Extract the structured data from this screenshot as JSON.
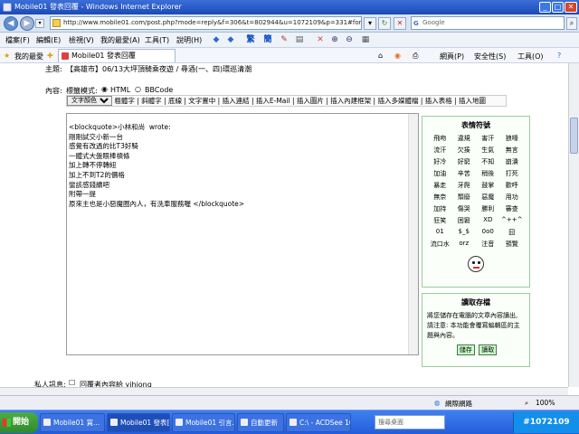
{
  "window": {
    "title": "Mobile01 發表回覆 - Windows Internet Explorer",
    "url": "http://www.mobile01.com/post.php?mode=reply&f=306&t=802944&u=1072109&p=331#form",
    "search_placeholder": "Google"
  },
  "menu": {
    "items": [
      "檔案(F)",
      "編輯(E)",
      "檢視(V)",
      "我的最愛(A)",
      "工具(T)",
      "說明(H)"
    ],
    "toolbar_text": [
      "繁",
      "簡"
    ]
  },
  "favbar": {
    "favorites_label": "我的最愛",
    "tab_label": "Mobile01 發表回覆",
    "page_label": "網頁(P)",
    "safety_label": "安全性(S)",
    "tools_label": "工具(O)"
  },
  "form": {
    "subject_label": "主題:",
    "subject_text": "【高雄市】06/13大坪頂騎乘夜遊 / 尋酒(一、四)環巡清潮",
    "content_label": "內容:",
    "mode_label": "標籤模式:",
    "mode_html": "HTML",
    "mode_bbcode": "BBCode",
    "color_select": "文字顏色",
    "format_links": [
      "粗體字",
      "斜體字",
      "底線",
      "文字置中",
      "插入連結",
      "插入E-Mail",
      "插入圖片",
      "插入內建框架",
      "插入多媒體檔",
      "插入表格",
      "插入地圖"
    ],
    "body_lines": [
      "<blockquote>小林和尚  wrote:",
      "剛剛試交小新一台",
      "感覺有改過的比T3好騎",
      "一體式大盤眼棒槓條",
      "加上轉不停轉紐",
      "加上不到T2的價格",
      "蠻該感錢續吧",
      "附帶一提",
      "原來主也是小惡魔圈內人，有洗車服務喔 </blockquote>"
    ],
    "private_label": "私人訊息:",
    "private_text": "回覆者內容給 yihjong"
  },
  "emoticons": {
    "title": "表情符號",
    "items": [
      "飛吻",
      "違規",
      "害汗",
      "狼嚎",
      "流汗",
      "欠揍",
      "生氣",
      "無言",
      "好冷",
      "好窮",
      "不知",
      "崩潰",
      "加油",
      "辛苦",
      "稍後",
      "打死",
      "暴走",
      "牙爬",
      "鼓掌",
      "歡呼",
      "無奈",
      "頹廢",
      "惡魔",
      "用功",
      "加持",
      "傷哭",
      "勝利",
      "審查",
      "狂笑",
      "困窘",
      "XD",
      "^++^",
      "01",
      "$_$",
      "0o0",
      "囧",
      "流口水",
      "orz",
      "注音",
      "預覽"
    ]
  },
  "autosave": {
    "title": "讀取存檔",
    "description": "將您儲存在電腦的文章內容讀出, 請注意: 本功能會覆寫編輯區的主題與內容。",
    "save_button": "儲存",
    "load_button": "讀取"
  },
  "status": {
    "zone": "網際網路",
    "zoom": "100%"
  },
  "taskbar": {
    "start": "開始",
    "tasks": [
      "Mobile01 賞...",
      "Mobile01 發表回覆...",
      "Mobile01 引言...",
      "自動更新",
      "C:\\ - ACDSee 10"
    ],
    "desktop_search": "搜尋桌面",
    "tray_text": "#1072109"
  }
}
